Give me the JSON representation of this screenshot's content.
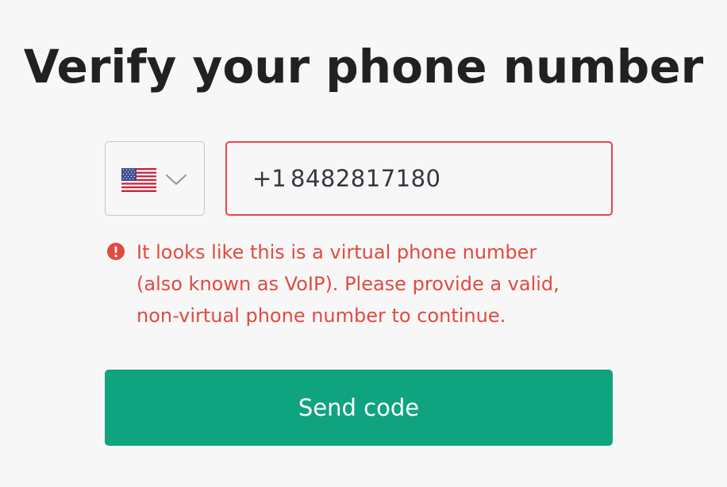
{
  "page": {
    "title": "Verify your phone number"
  },
  "phone_form": {
    "country": {
      "flag_icon": "us-flag-icon",
      "dropdown_icon": "chevron-down-icon"
    },
    "dial_code": "+1",
    "phone_number": "8482817180",
    "error": {
      "icon": "exclamation-circle-icon",
      "lines": [
        "It looks like this is a virtual phone number",
        "(also known as VoIP). Please provide a valid,",
        "non-virtual phone number to continue."
      ]
    },
    "submit_label": "Send code"
  },
  "colors": {
    "background": "#f7f7f8",
    "title": "#202123",
    "error": "#ef4146",
    "error_text": "#e34a3e",
    "button": "#10a37f",
    "button_text": "#ffffff",
    "border": "#c2c8d0"
  }
}
